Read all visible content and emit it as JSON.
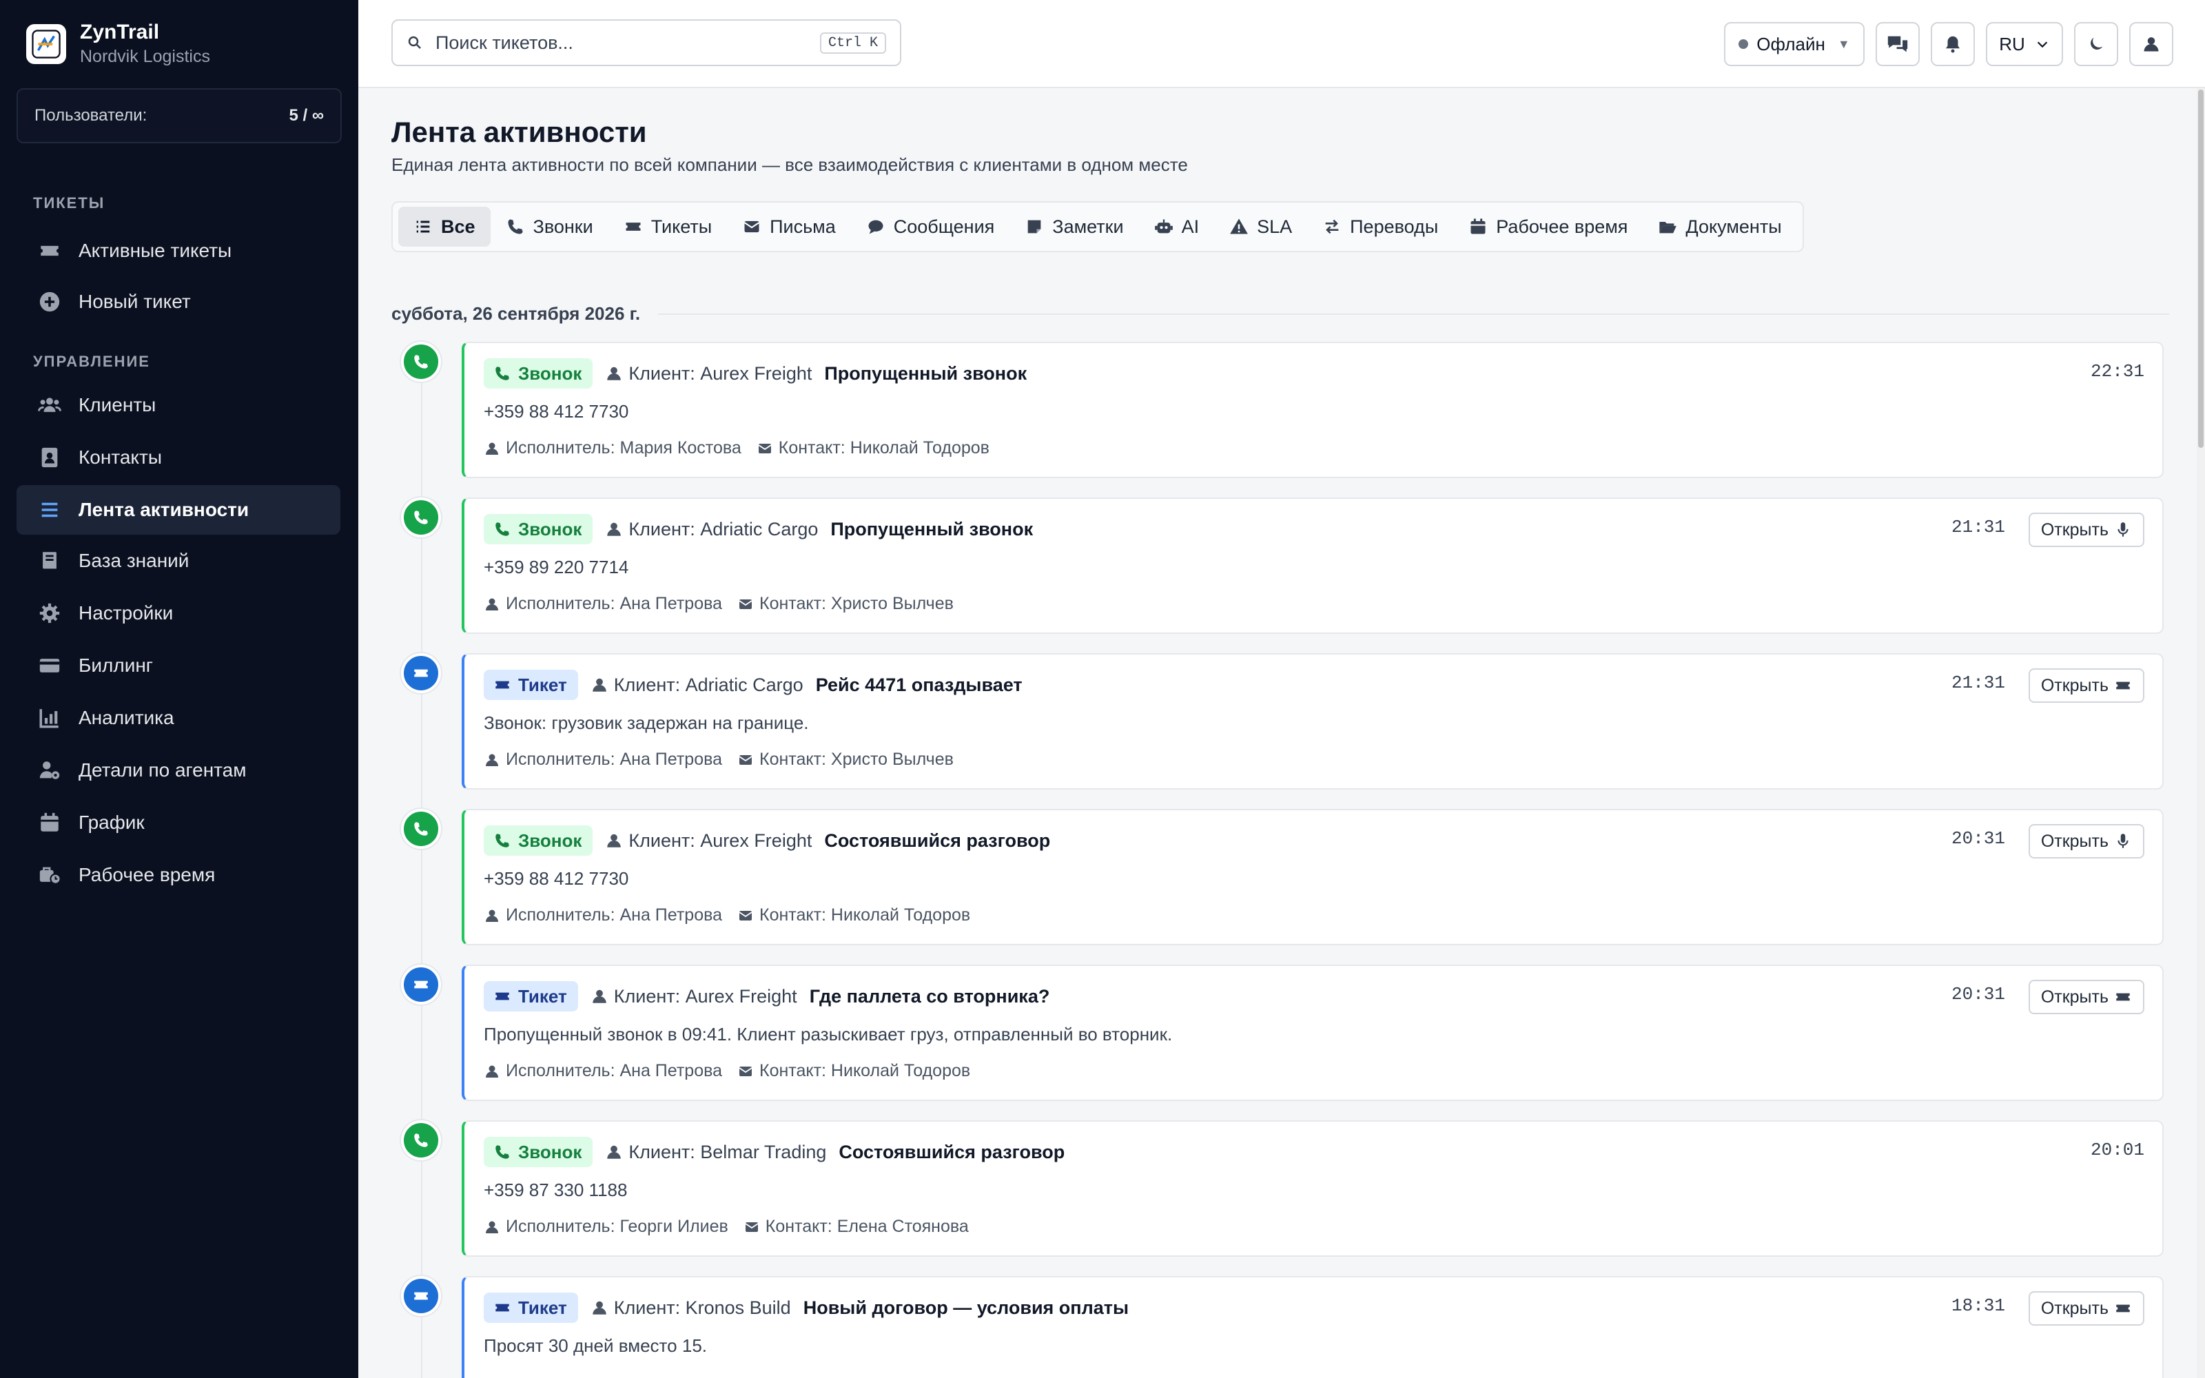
{
  "app": {
    "name": "ZynTrail",
    "org": "Nordvik Logistics"
  },
  "users": {
    "label": "Пользователи:",
    "value": "5 / ∞"
  },
  "sidebar": {
    "sections": [
      "ТИКЕТЫ",
      "УПРАВЛЕНИЕ"
    ],
    "items": [
      {
        "label": "Активные тикеты",
        "icon": "ticket-icon"
      },
      {
        "label": "Новый тикет",
        "icon": "plus-circle-icon"
      },
      {
        "label": "Клиенты",
        "icon": "users-icon"
      },
      {
        "label": "Контакты",
        "icon": "address-book-icon"
      },
      {
        "label": "Лента активности",
        "icon": "list-icon",
        "active": true
      },
      {
        "label": "База знаний",
        "icon": "book-icon"
      },
      {
        "label": "Настройки",
        "icon": "gear-icon"
      },
      {
        "label": "Биллинг",
        "icon": "credit-card-icon"
      },
      {
        "label": "Аналитика",
        "icon": "chart-icon"
      },
      {
        "label": "Детали по агентам",
        "icon": "user-gear-icon"
      },
      {
        "label": "График",
        "icon": "calendar-icon"
      },
      {
        "label": "Рабочее время",
        "icon": "business-time-icon"
      }
    ]
  },
  "header": {
    "search_placeholder": "Поиск тикетов...",
    "shortcut": "Ctrl K",
    "status": "Офлайн",
    "lang": "RU"
  },
  "page": {
    "title": "Лента активности",
    "subtitle": "Единая лента активности по всей компании — все взаимодействия с клиентами в одном месте"
  },
  "filters": [
    "Все",
    "Звонки",
    "Тикеты",
    "Письма",
    "Сообщения",
    "Заметки",
    "AI",
    "SLA",
    "Переводы",
    "Рабочее время",
    "Документы"
  ],
  "date_label": "суббота, 26 сентября 2026 г.",
  "open_label": "Открыть",
  "feed": [
    {
      "type": "call",
      "badge": "Звонок",
      "client": "Клиент: Aurex Freight",
      "subject": "Пропущенный звонок",
      "body": "+359 88 412 7730",
      "assignee": "Исполнитель: Мария Костова",
      "contact": "Контакт: Николай Тодоров",
      "time": "22:31",
      "open": false
    },
    {
      "type": "call",
      "badge": "Звонок",
      "client": "Клиент: Adriatic Cargo",
      "subject": "Пропущенный звонок",
      "body": "+359 89 220 7714",
      "assignee": "Исполнитель: Ана Петрова",
      "contact": "Контакт: Христо Вылчев",
      "time": "21:31",
      "open": true
    },
    {
      "type": "ticket",
      "badge": "Тикет",
      "client": "Клиент: Adriatic Cargo",
      "subject": "Рейс 4471 опаздывает",
      "body": "Звонок: грузовик задержан на границе.",
      "assignee": "Исполнитель: Ана Петрова",
      "contact": "Контакт: Христо Вылчев",
      "time": "21:31",
      "open": true
    },
    {
      "type": "call",
      "badge": "Звонок",
      "client": "Клиент: Aurex Freight",
      "subject": "Состоявшийся разговор",
      "body": "+359 88 412 7730",
      "assignee": "Исполнитель: Ана Петрова",
      "contact": "Контакт: Николай Тодоров",
      "time": "20:31",
      "open": true
    },
    {
      "type": "ticket",
      "badge": "Тикет",
      "client": "Клиент: Aurex Freight",
      "subject": "Где паллета со вторника?",
      "body": "Пропущенный звонок в 09:41. Клиент разыскивает груз, отправленный во вторник.",
      "assignee": "Исполнитель: Ана Петрова",
      "contact": "Контакт: Николай Тодоров",
      "time": "20:31",
      "open": true
    },
    {
      "type": "call",
      "badge": "Звонок",
      "client": "Клиент: Belmar Trading",
      "subject": "Состоявшийся разговор",
      "body": "+359 87 330 1188",
      "assignee": "Исполнитель: Георги Илиев",
      "contact": "Контакт: Елена Стоянова",
      "time": "20:01",
      "open": false
    },
    {
      "type": "ticket",
      "badge": "Тикет",
      "client": "Клиент: Kronos Build",
      "subject": "Новый договор — условия оплаты",
      "body": "Просят 30 дней вместо 15.",
      "assignee": "",
      "contact": "",
      "time": "18:31",
      "open": true
    }
  ]
}
